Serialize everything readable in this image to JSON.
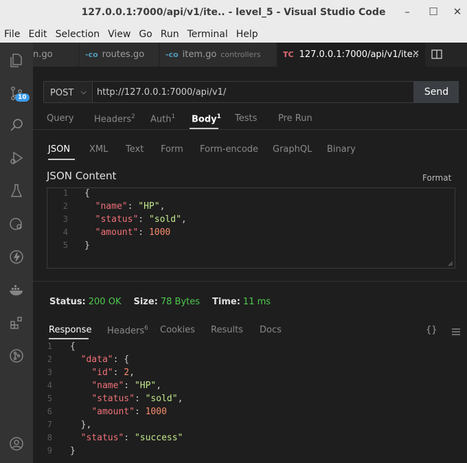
{
  "window": {
    "title": "127.0.0.1:7000/api/v1/ite.. - level_5 - Visual Studio Code",
    "controls": [
      "–",
      "☐",
      "✕"
    ]
  },
  "menu": [
    "File",
    "Edit",
    "Selection",
    "View",
    "Go",
    "Run",
    "Terminal",
    "Help"
  ],
  "activity_bar": {
    "scm_badge": "10",
    "icons": [
      "explorer-icon",
      "source-control-icon",
      "search-icon",
      "run-debug-icon",
      "testing-icon",
      "remote-icon",
      "thunder-client-icon",
      "docker-icon",
      "extensions-icon",
      "git-graph-icon",
      "account-icon"
    ]
  },
  "tabs": [
    {
      "icon": "",
      "label": "n.go",
      "desc": ""
    },
    {
      "icon": "-co",
      "label": "routes.go",
      "desc": ""
    },
    {
      "icon": "-co",
      "label": "item.go",
      "desc": "controllers"
    },
    {
      "icon": "TC",
      "label": "127.0.0.1:7000/api/v1/ite..",
      "desc": "",
      "close": "✕"
    }
  ],
  "request": {
    "method": "POST",
    "url": "http://127.0.0.1:7000/api/v1/",
    "send": "Send"
  },
  "request_tabs": [
    {
      "label": "Query",
      "count": ""
    },
    {
      "label": "Headers",
      "count": "2"
    },
    {
      "label": "Auth",
      "count": "1"
    },
    {
      "label": "Body",
      "count": "1"
    },
    {
      "label": "Tests",
      "count": ""
    },
    {
      "label": "Pre Run",
      "count": ""
    }
  ],
  "body_tabs": [
    "JSON",
    "XML",
    "Text",
    "Form",
    "Form-encode",
    "GraphQL",
    "Binary"
  ],
  "json_content": {
    "label": "JSON Content",
    "format": "Format",
    "line_numbers": [
      "1",
      "2",
      "3",
      "4",
      "5"
    ],
    "open": "{",
    "name_key": "\"name\"",
    "name_val": "\"HP\"",
    "status_key": "\"status\"",
    "status_val": "\"sold\"",
    "amount_key": "\"amount\"",
    "amount_val": "1000",
    "close": "}"
  },
  "status_bar": {
    "status_label": "Status:",
    "status_value": "200 OK",
    "size_label": "Size:",
    "size_value": "78 Bytes",
    "time_label": "Time:",
    "time_value": "11 ms"
  },
  "response_tabs": [
    {
      "label": "Response",
      "count": ""
    },
    {
      "label": "Headers",
      "count": "6"
    },
    {
      "label": "Cookies",
      "count": ""
    },
    {
      "label": "Results",
      "count": ""
    },
    {
      "label": "Docs",
      "count": ""
    }
  ],
  "response_icons": {
    "braces": "{}"
  },
  "response": {
    "line_numbers": [
      "1",
      "2",
      "3",
      "4",
      "5",
      "6",
      "7",
      "8",
      "9"
    ],
    "open": "{",
    "data_key": "\"data\"",
    "data_open": "{",
    "id_key": "\"id\"",
    "id_val": "2",
    "name_key": "\"name\"",
    "name_val": "\"HP\"",
    "status_key": "\"status\"",
    "status_val": "\"sold\"",
    "amount_key": "\"amount\"",
    "amount_val": "1000",
    "data_close": "},",
    "outer_status_key": "\"status\"",
    "outer_status_val": "\"success\"",
    "close": "}"
  }
}
